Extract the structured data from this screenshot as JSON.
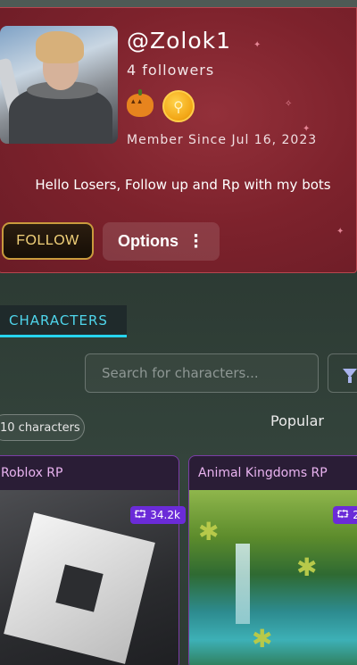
{
  "profile": {
    "username": "@Zolok1",
    "followers": "4 followers",
    "member_since": "Member Since Jul 16, 2023",
    "bio": "Hello Losers, Follow up and Rp with my bots",
    "badges": [
      "pumpkin-badge",
      "coin-badge"
    ],
    "coin_glyph": "♀",
    "accent": "#7d222c"
  },
  "actions": {
    "follow_label": "FOLLOW",
    "options_label": "Options",
    "kebab": "⋮"
  },
  "tabs": {
    "characters_label": "CHARACTERS"
  },
  "search": {
    "placeholder": "Search for characters..."
  },
  "list": {
    "count_label": "10 characters",
    "sort_label": "Popular"
  },
  "cards": [
    {
      "title": "Roblox RP",
      "chats": "34.2k"
    },
    {
      "title": "Animal Kingdoms RP",
      "chats": "2"
    }
  ],
  "chat_icon": "⮔"
}
